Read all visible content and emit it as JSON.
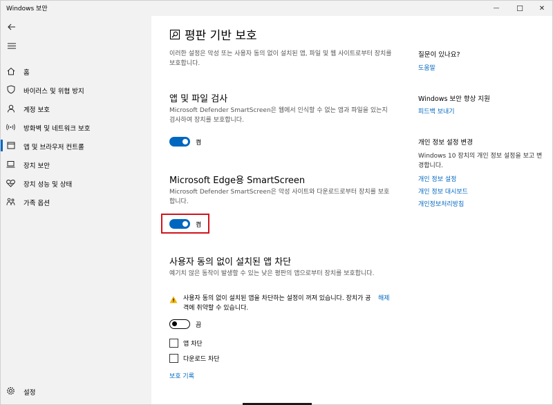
{
  "window": {
    "title": "Windows 보안",
    "controls": {
      "minimize": "—",
      "maximize": "☐",
      "close": "✕"
    }
  },
  "sidebar": {
    "items": [
      {
        "label": "홈",
        "icon": "home-icon"
      },
      {
        "label": "바이러스 및 위협 방지",
        "icon": "shield-icon"
      },
      {
        "label": "계정 보호",
        "icon": "person-icon"
      },
      {
        "label": "방화벽 및 네트워크 보호",
        "icon": "antenna-icon"
      },
      {
        "label": "앱 및 브라우저 컨트롤",
        "icon": "app-window-icon",
        "active": true
      },
      {
        "label": "장치 보안",
        "icon": "laptop-icon"
      },
      {
        "label": "장치 성능 및 상태",
        "icon": "heart-icon"
      },
      {
        "label": "가족 옵션",
        "icon": "family-icon"
      }
    ],
    "settings_label": "설정"
  },
  "main": {
    "title": "평판 기반 보호",
    "intro": "이러한 설정은 악성 또는 사용자 동의 없이 설치된 앱, 파일 및 웹 사이트로부터 장치를 보호합니다.",
    "sections": {
      "app_file_check": {
        "title": "앱 및 파일 검사",
        "desc": "Microsoft Defender SmartScreen은 웹에서 인식할 수 없는 앱과 파일을 있는지 검사하여 장치를 보호합니다.",
        "toggle_label": "켬"
      },
      "edge_smartscreen": {
        "title": "Microsoft Edge용 SmartScreen",
        "desc": "Microsoft Defender SmartScreen은 악성 사이트와 다운로드로부터 장치를 보호합니다.",
        "toggle_label": "켬"
      },
      "pua_block": {
        "title": "사용자 동의 없이 설치된 앱 차단",
        "desc": "예기치 않은 동작이 발생할 수 있는 낮은 평판의 앱으로부터 장치를 보호합니다.",
        "warning_text": "사용자 동의 없이 설치된 앱을 차단하는 설정이 꺼져 있습니다. 장치가 공격에 취약할 수 있습니다.",
        "warning_link": "해제",
        "toggle_label": "끔",
        "checkbox_block_apps": "앱 차단",
        "checkbox_block_downloads": "다운로드 차단",
        "history_link": "보호 기록"
      }
    }
  },
  "right": {
    "question_head": "질문이 있나요?",
    "help_link": "도움말",
    "improve_head": "Windows 보안 향상 지원",
    "feedback_link": "피드백 보내기",
    "privacy_head": "개인 정보 설정 변경",
    "privacy_text": "Windows 10 장치의 개인 정보 설정을 보고 변경합니다.",
    "privacy_settings_link": "개인 정보 설정",
    "privacy_dashboard_link": "개인 정보 대시보드",
    "privacy_statement_link": "개인정보처리방침"
  },
  "colors": {
    "accent": "#0067c0",
    "highlight": "#d0121b",
    "warning": "#f3b500"
  }
}
